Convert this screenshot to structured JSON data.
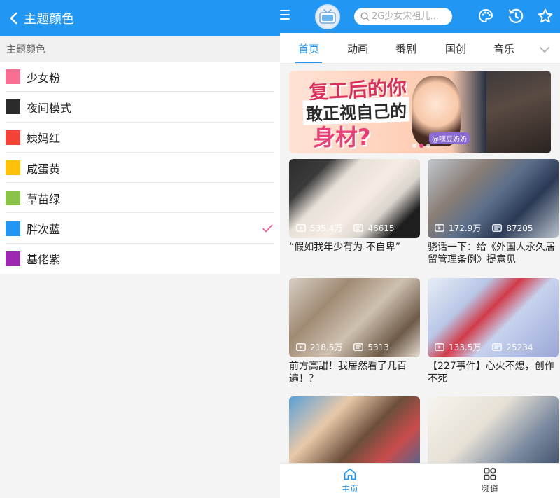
{
  "left_panel": {
    "title": "主题颜色",
    "section_label": "主题颜色",
    "themes": [
      {
        "label": "少女粉",
        "color": "#f96e93",
        "selected": false
      },
      {
        "label": "夜间模式",
        "color": "#2b2b2b",
        "selected": false
      },
      {
        "label": "姨妈红",
        "color": "#f44336",
        "selected": false
      },
      {
        "label": "咸蛋黄",
        "color": "#ffc107",
        "selected": false
      },
      {
        "label": "草苗绿",
        "color": "#8bc34a",
        "selected": false
      },
      {
        "label": "胖次蓝",
        "color": "#2196f3",
        "selected": true
      },
      {
        "label": "基佬紫",
        "color": "#9c27b0",
        "selected": false
      }
    ],
    "check_color": "#f06292"
  },
  "right_panel": {
    "search_placeholder": "2G少女宋祖儿...",
    "tabs": [
      "首页",
      "动画",
      "番剧",
      "国创",
      "音乐"
    ],
    "active_tab": 0,
    "banner": {
      "line1": "复工后的你",
      "line2": "敢正视自己的",
      "line3": "身材?",
      "credit": "@嘿豆奶奶",
      "page_count": 3,
      "active_page": 1
    },
    "videos": [
      {
        "title": "“假如我年少有为 不自卑”",
        "plays": "535.4万",
        "danmaku": "46615"
      },
      {
        "title": "骁话一下：给《外国人永久居留管理条例》提意见",
        "plays": "172.9万",
        "danmaku": "87205"
      },
      {
        "title": "前方高甜！我居然看了几百遍！？",
        "plays": "218.5万",
        "danmaku": "5313"
      },
      {
        "title": "【227事件】心火不熄，创作不死",
        "plays": "133.5万",
        "danmaku": "25234"
      },
      {
        "title": "",
        "plays": "",
        "danmaku": ""
      },
      {
        "title": "",
        "plays": "",
        "danmaku": ""
      }
    ],
    "bottom_nav": [
      {
        "label": "主页",
        "active": true
      },
      {
        "label": "频道",
        "active": false
      }
    ],
    "accent_color": "#2196f3"
  }
}
